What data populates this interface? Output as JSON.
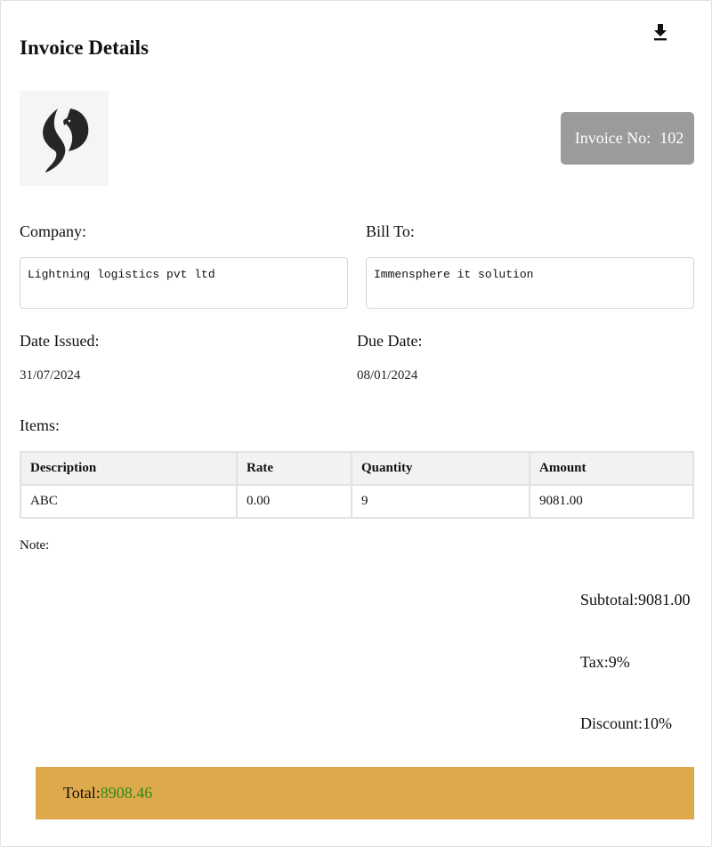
{
  "header": {
    "title": "Invoice Details",
    "download_icon": "download-icon"
  },
  "logo": {
    "icon": "phoenix-bird-logo"
  },
  "invoice": {
    "label": "Invoice No:",
    "number": "102"
  },
  "company": {
    "label": "Company:",
    "value": "Lightning logistics pvt ltd"
  },
  "bill_to": {
    "label": "Bill To:",
    "value": "Immensphere it solution"
  },
  "dates": {
    "issued_label": "Date Issued:",
    "issued_value": "31/07/2024",
    "due_label": "Due Date:",
    "due_value": "08/01/2024"
  },
  "items": {
    "label": "Items:",
    "headers": [
      "Description",
      "Rate",
      "Quantity",
      "Amount"
    ],
    "rows": [
      [
        "ABC",
        "0.00",
        "9",
        "9081.00"
      ]
    ]
  },
  "note": {
    "label": "Note:"
  },
  "summary": {
    "subtotal_label": "Subtotal:",
    "subtotal_value": "9081.00",
    "tax_label": "Tax:",
    "tax_value": "9%",
    "discount_label": "Discount:",
    "discount_value": "10%"
  },
  "total": {
    "label": "Total:",
    "value": "8908.46"
  },
  "colors": {
    "badge_bg": "#9b9b9b",
    "total_bar_bg": "#dea94b",
    "total_value": "#2e8b1a"
  }
}
